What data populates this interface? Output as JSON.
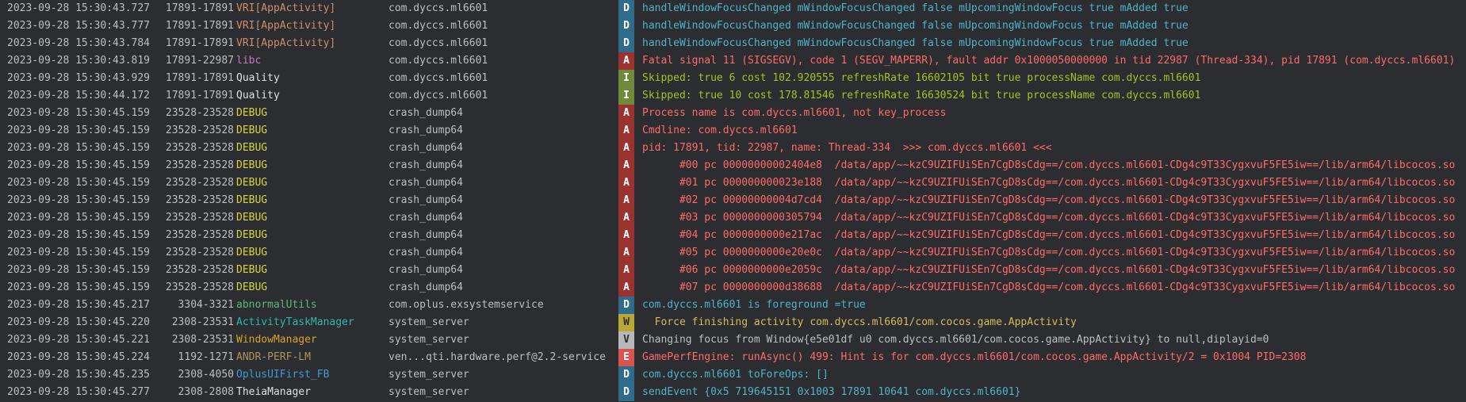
{
  "level_colors": {
    "D": {
      "bg": "#2f6b8a",
      "fg": "#4fb3c9"
    },
    "A": {
      "bg": "#9a3330",
      "fg": "#ff6b68"
    },
    "I": {
      "bg": "#6f8a3a",
      "fg": "#a8c023"
    },
    "W": {
      "bg": "#b9a739",
      "fg": "#d4bb5a"
    },
    "V": {
      "bg": "#b8b8b8",
      "fg": "#bcbec4"
    },
    "E": {
      "bg": "#d9544f",
      "fg": "#ff6b68"
    }
  },
  "rows": [
    {
      "ts": "2023-09-28 15:30:43.727",
      "pid": "17891-17891",
      "tag": "VRI[AppActivity]",
      "tag_color": "#cf8e6d",
      "pkg": "com.dyccs.ml6601",
      "level": "D",
      "msg": "handleWindowFocusChanged mWindowFocusChanged false mUpcomingWindowFocus true mAdded true"
    },
    {
      "ts": "2023-09-28 15:30:43.777",
      "pid": "17891-17891",
      "tag": "VRI[AppActivity]",
      "tag_color": "#cf8e6d",
      "pkg": "com.dyccs.ml6601",
      "level": "D",
      "msg": "handleWindowFocusChanged mWindowFocusChanged false mUpcomingWindowFocus true mAdded true"
    },
    {
      "ts": "2023-09-28 15:30:43.784",
      "pid": "17891-17891",
      "tag": "VRI[AppActivity]",
      "tag_color": "#cf8e6d",
      "pkg": "com.dyccs.ml6601",
      "level": "D",
      "msg": "handleWindowFocusChanged mWindowFocusChanged false mUpcomingWindowFocus true mAdded true"
    },
    {
      "ts": "2023-09-28 15:30:43.819",
      "pid": "17891-22987",
      "tag": "libc",
      "tag_color": "#c77dbb",
      "pkg": "com.dyccs.ml6601",
      "level": "A",
      "msg": "Fatal signal 11 (SIGSEGV), code 1 (SEGV_MAPERR), fault addr 0x1000050000000 in tid 22987 (Thread-334), pid 17891 (com.dyccs.ml6601)"
    },
    {
      "ts": "2023-09-28 15:30:43.929",
      "pid": "17891-17891",
      "tag": "Quality",
      "tag_color": "#dfe1e5",
      "pkg": "com.dyccs.ml6601",
      "level": "I",
      "msg": "Skipped: true 6 cost 102.920555 refreshRate 16602105 bit true processName com.dyccs.ml6601"
    },
    {
      "ts": "2023-09-28 15:30:44.172",
      "pid": "17891-17891",
      "tag": "Quality",
      "tag_color": "#dfe1e5",
      "pkg": "com.dyccs.ml6601",
      "level": "I",
      "msg": "Skipped: true 10 cost 178.81546 refreshRate 16630524 bit true processName com.dyccs.ml6601"
    },
    {
      "ts": "2023-09-28 15:30:45.159",
      "pid": "23528-23528",
      "tag": "DEBUG",
      "tag_color": "#d6d642",
      "pkg": "crash_dump64",
      "level": "A",
      "msg": "Process name is com.dyccs.ml6601, not key_process"
    },
    {
      "ts": "2023-09-28 15:30:45.159",
      "pid": "23528-23528",
      "tag": "DEBUG",
      "tag_color": "#d6d642",
      "pkg": "crash_dump64",
      "level": "A",
      "msg": "Cmdline: com.dyccs.ml6601"
    },
    {
      "ts": "2023-09-28 15:30:45.159",
      "pid": "23528-23528",
      "tag": "DEBUG",
      "tag_color": "#d6d642",
      "pkg": "crash_dump64",
      "level": "A",
      "msg": "pid: 17891, tid: 22987, name: Thread-334  >>> com.dyccs.ml6601 <<<"
    },
    {
      "ts": "2023-09-28 15:30:45.159",
      "pid": "23528-23528",
      "tag": "DEBUG",
      "tag_color": "#d6d642",
      "pkg": "crash_dump64",
      "level": "A",
      "msg": "      #00 pc 00000000002404e8  /data/app/~~kzC9UZIFUiSEn7CgD8sCdg==/com.dyccs.ml6601-CDg4c9T33CygxvuF5FE5iw==/lib/arm64/libcocos.so"
    },
    {
      "ts": "2023-09-28 15:30:45.159",
      "pid": "23528-23528",
      "tag": "DEBUG",
      "tag_color": "#d6d642",
      "pkg": "crash_dump64",
      "level": "A",
      "msg": "      #01 pc 000000000023e188  /data/app/~~kzC9UZIFUiSEn7CgD8sCdg==/com.dyccs.ml6601-CDg4c9T33CygxvuF5FE5iw==/lib/arm64/libcocos.so"
    },
    {
      "ts": "2023-09-28 15:30:45.159",
      "pid": "23528-23528",
      "tag": "DEBUG",
      "tag_color": "#d6d642",
      "pkg": "crash_dump64",
      "level": "A",
      "msg": "      #02 pc 00000000004d7cd4  /data/app/~~kzC9UZIFUiSEn7CgD8sCdg==/com.dyccs.ml6601-CDg4c9T33CygxvuF5FE5iw==/lib/arm64/libcocos.so"
    },
    {
      "ts": "2023-09-28 15:30:45.159",
      "pid": "23528-23528",
      "tag": "DEBUG",
      "tag_color": "#d6d642",
      "pkg": "crash_dump64",
      "level": "A",
      "msg": "      #03 pc 0000000000305794  /data/app/~~kzC9UZIFUiSEn7CgD8sCdg==/com.dyccs.ml6601-CDg4c9T33CygxvuF5FE5iw==/lib/arm64/libcocos.so"
    },
    {
      "ts": "2023-09-28 15:30:45.159",
      "pid": "23528-23528",
      "tag": "DEBUG",
      "tag_color": "#d6d642",
      "pkg": "crash_dump64",
      "level": "A",
      "msg": "      #04 pc 0000000000e217ac  /data/app/~~kzC9UZIFUiSEn7CgD8sCdg==/com.dyccs.ml6601-CDg4c9T33CygxvuF5FE5iw==/lib/arm64/libcocos.so"
    },
    {
      "ts": "2023-09-28 15:30:45.159",
      "pid": "23528-23528",
      "tag": "DEBUG",
      "tag_color": "#d6d642",
      "pkg": "crash_dump64",
      "level": "A",
      "msg": "      #05 pc 0000000000e20e0c  /data/app/~~kzC9UZIFUiSEn7CgD8sCdg==/com.dyccs.ml6601-CDg4c9T33CygxvuF5FE5iw==/lib/arm64/libcocos.so"
    },
    {
      "ts": "2023-09-28 15:30:45.159",
      "pid": "23528-23528",
      "tag": "DEBUG",
      "tag_color": "#d6d642",
      "pkg": "crash_dump64",
      "level": "A",
      "msg": "      #06 pc 0000000000e2059c  /data/app/~~kzC9UZIFUiSEn7CgD8sCdg==/com.dyccs.ml6601-CDg4c9T33CygxvuF5FE5iw==/lib/arm64/libcocos.so"
    },
    {
      "ts": "2023-09-28 15:30:45.159",
      "pid": "23528-23528",
      "tag": "DEBUG",
      "tag_color": "#d6d642",
      "pkg": "crash_dump64",
      "level": "A",
      "msg": "      #07 pc 0000000000d38688  /data/app/~~kzC9UZIFUiSEn7CgD8sCdg==/com.dyccs.ml6601-CDg4c9T33CygxvuF5FE5iw==/lib/arm64/libcocos.so"
    },
    {
      "ts": "2023-09-28 15:30:45.217",
      "pid": "3304-3321",
      "tag": "abnormalUtils",
      "tag_color": "#5fb878",
      "pkg": "com.oplus.exsystemservice",
      "level": "D",
      "msg": "com.dyccs.ml6601 is foreground =true"
    },
    {
      "ts": "2023-09-28 15:30:45.220",
      "pid": "2308-23531",
      "tag": "ActivityTaskManager",
      "tag_color": "#2fb8a6",
      "pkg": "system_server",
      "level": "W",
      "msg": "  Force finishing activity com.dyccs.ml6601/com.cocos.game.AppActivity"
    },
    {
      "ts": "2023-09-28 15:30:45.221",
      "pid": "2308-23531",
      "tag": "WindowManager",
      "tag_color": "#d6a52a",
      "pkg": "system_server",
      "level": "V",
      "msg": "Changing focus from Window{e5e01df u0 com.dyccs.ml6601/com.cocos.game.AppActivity} to null,diplayid=0"
    },
    {
      "ts": "2023-09-28 15:30:45.224",
      "pid": "1192-1271",
      "tag": "ANDR-PERF-LM",
      "tag_color": "#a9955b",
      "pkg": "ven...qti.hardware.perf@2.2-service",
      "level": "E",
      "msg": "GamePerfEngine: runAsync() 499: Hint is for com.dyccs.ml6601/com.cocos.game.AppActivity/2 = 0x1004 PID=2308"
    },
    {
      "ts": "2023-09-28 15:30:45.235",
      "pid": "2308-4050",
      "tag": "OplusUIFirst_FB",
      "tag_color": "#3d9bd8",
      "pkg": "system_server",
      "level": "D",
      "msg": "com.dyccs.ml6601 toForeOps: []"
    },
    {
      "ts": "2023-09-28 15:30:45.277",
      "pid": "2308-2808",
      "tag": "TheiaManager",
      "tag_color": "#dfe1e5",
      "pkg": "system_server",
      "level": "D",
      "msg": "sendEvent {0x5 719645151 0x1003 17891 10641 com.dyccs.ml6601}"
    }
  ]
}
